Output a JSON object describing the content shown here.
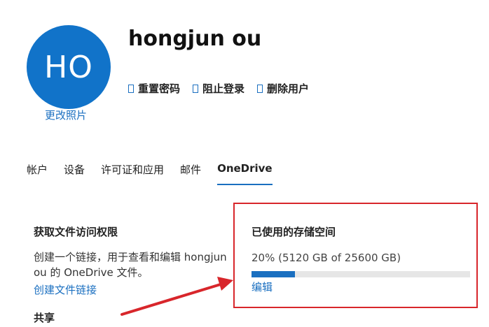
{
  "user": {
    "initials": "HO",
    "name": "hongjun ou",
    "change_photo": "更改照片",
    "avatar_color": "#1173c9"
  },
  "actions": [
    {
      "label": "重置密码",
      "icon": "key-icon"
    },
    {
      "label": "阻止登录",
      "icon": "block-icon"
    },
    {
      "label": "删除用户",
      "icon": "delete-icon"
    }
  ],
  "tabs": [
    {
      "label": "帐户",
      "active": false
    },
    {
      "label": "设备",
      "active": false
    },
    {
      "label": "许可证和应用",
      "active": false
    },
    {
      "label": "邮件",
      "active": false
    },
    {
      "label": "OneDrive",
      "active": true
    }
  ],
  "access": {
    "title": "获取文件访问权限",
    "description": "创建一个链接，用于查看和编辑 hongjun ou 的 OneDrive 文件。",
    "link": "创建文件链接"
  },
  "sharing": {
    "title": "共享"
  },
  "storage": {
    "title": "已使用的存储空间",
    "usage_text": "20% (5120 GB of 25600 GB)",
    "percent": 20,
    "edit": "编辑"
  },
  "colors": {
    "accent": "#1a6fc0",
    "highlight": "#d8262b"
  }
}
